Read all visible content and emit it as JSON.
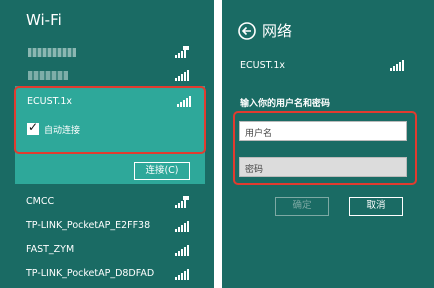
{
  "left_panel": {
    "title": "Wi-Fi",
    "networks_top": [
      {
        "name": "",
        "signal_icon": "wifi-signal-secured-icon"
      },
      {
        "name": "",
        "signal_icon": "wifi-signal-icon"
      }
    ],
    "selected_network": {
      "name": "ECUST.1x",
      "auto_connect_label": "自动连接",
      "auto_connect_checked": true,
      "connect_label": "连接(C)"
    },
    "networks_bottom": [
      {
        "name": "CMCC",
        "signal_icon": "wifi-signal-secured-icon"
      },
      {
        "name": "TP-LINK_PocketAP_E2FF38",
        "signal_icon": "wifi-signal-icon"
      },
      {
        "name": "FAST_ZYM",
        "signal_icon": "wifi-signal-icon"
      },
      {
        "name": "TP-LINK_PocketAP_D8DFAD",
        "signal_icon": "wifi-signal-icon"
      }
    ]
  },
  "right_panel": {
    "title": "网络",
    "network_name": "ECUST.1x",
    "prompt": "输入你的用户名和密码",
    "username_placeholder": "用户名",
    "password_placeholder": "密码",
    "ok_label": "确定",
    "cancel_label": "取消"
  },
  "colors": {
    "panel_bg": "#1a6b64",
    "selected_bg": "#2ea89a",
    "highlight": "#e23b2f"
  }
}
